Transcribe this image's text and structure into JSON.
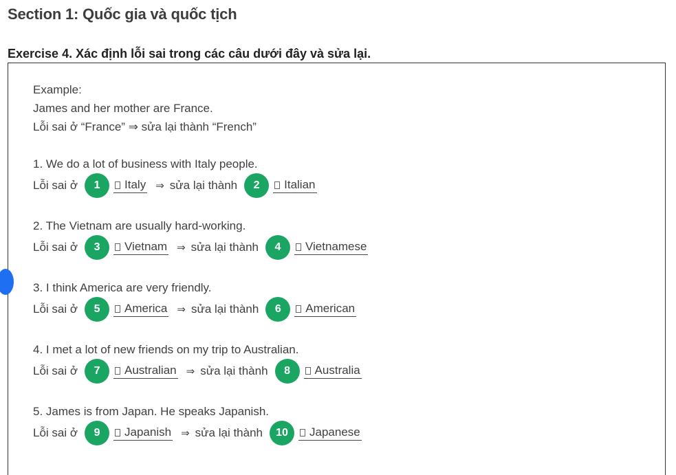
{
  "section_title": "Section 1: Quốc gia và quốc tịch",
  "exercise_title": "Exercise 4. Xác định lỗi sai trong các câu dưới đây và sửa lại.",
  "example": {
    "heading": "Example:",
    "sentence": "James and her mother are France.",
    "explanation": "Lỗi sai ở “France” ⇒ sửa lại thành “French”"
  },
  "labels": {
    "error_at": "Lỗi sai ở",
    "arrow": "⇒",
    "fix_to": "sửa lại thành"
  },
  "colors": {
    "badge": "#1aa562",
    "side_dot": "#1e6ff1"
  },
  "questions": [
    {
      "sentence": "1. We do a lot of business with Italy people.",
      "error_num": "1",
      "error": "Italy",
      "fix_num": "2",
      "fix": "Italian"
    },
    {
      "sentence": "2. The Vietnam are usually hard-working.",
      "error_num": "3",
      "error": "Vietnam",
      "fix_num": "4",
      "fix": "Vietnamese"
    },
    {
      "sentence": "3. I think America are very friendly.",
      "error_num": "5",
      "error": "America",
      "fix_num": "6",
      "fix": "American"
    },
    {
      "sentence": "4. I met a lot of new friends on my trip to Australian.",
      "error_num": "7",
      "error": "Australian",
      "fix_num": "8",
      "fix": "Australia"
    },
    {
      "sentence": "5. James is from Japan. He speaks Japanish.",
      "error_num": "9",
      "error": "Japanish",
      "fix_num": "10",
      "fix": "Japanese"
    }
  ]
}
